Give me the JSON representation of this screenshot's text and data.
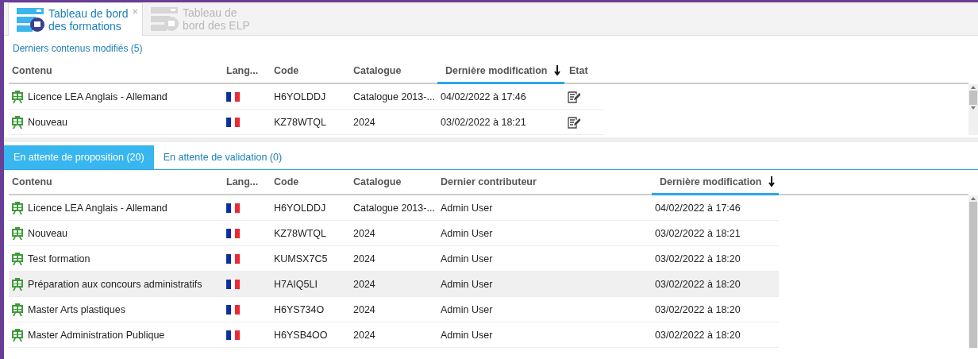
{
  "tabs": [
    {
      "label_lines": [
        "Tableau de bord",
        "des formations"
      ],
      "selected": true,
      "close": "×"
    },
    {
      "label_lines": [
        "Tableau de",
        "bord des ELP"
      ],
      "selected": false
    }
  ],
  "recent": {
    "title": "Derniers contenus modifiés (5)",
    "columns": [
      {
        "label": "Contenu",
        "kind": "content",
        "sorted": false
      },
      {
        "label": "Lang...",
        "kind": "language",
        "sorted": false
      },
      {
        "label": "Code",
        "kind": "code",
        "sorted": false
      },
      {
        "label": "Catalogue",
        "kind": "catalogue",
        "sorted": false
      },
      {
        "label": "Dernière modification",
        "kind": "modified",
        "sorted": true
      },
      {
        "label": "Etat",
        "kind": "status",
        "sorted": false
      }
    ],
    "rows": [
      {
        "content": "Licence LEA Anglais - Allemand",
        "code": "H6YOLDDJ",
        "catalogue": "Catalogue 2013-...",
        "modified": "04/02/2022 à 17:46",
        "highlighted": false
      },
      {
        "content": "Nouveau",
        "code": "KZ78WTQL",
        "catalogue": "2024",
        "modified": "03/02/2022 à 18:21",
        "highlighted": false
      }
    ]
  },
  "subtabs": [
    {
      "label": "En attente de proposition (20)",
      "selected": true
    },
    {
      "label": "En attente de validation (0)",
      "selected": false
    }
  ],
  "pending": {
    "columns": [
      {
        "label": "Contenu",
        "kind": "content",
        "sorted": false
      },
      {
        "label": "Lang...",
        "kind": "language",
        "sorted": false
      },
      {
        "label": "Code",
        "kind": "code",
        "sorted": false
      },
      {
        "label": "Catalogue",
        "kind": "catalogue",
        "sorted": false
      },
      {
        "label": "Dernier contributeur",
        "kind": "contributor",
        "sorted": false
      },
      {
        "label": "Dernière modification",
        "kind": "modified",
        "sorted": true
      }
    ],
    "rows": [
      {
        "content": "Licence LEA Anglais - Allemand",
        "code": "H6YOLDDJ",
        "catalogue": "Catalogue 2013-...",
        "contributor": "Admin User",
        "modified": "04/02/2022 à 17:46",
        "highlighted": false
      },
      {
        "content": "Nouveau",
        "code": "KZ78WTQL",
        "catalogue": "2024",
        "contributor": "Admin User",
        "modified": "03/02/2022 à 18:21",
        "highlighted": false
      },
      {
        "content": "Test formation",
        "code": "KUMSX7C5",
        "catalogue": "2024",
        "contributor": "Admin User",
        "modified": "03/02/2022 à 18:20",
        "highlighted": false
      },
      {
        "content": "Préparation aux concours administratifs",
        "code": "H7AIQ5LI",
        "catalogue": "2024",
        "contributor": "Admin User",
        "modified": "03/02/2022 à 18:20",
        "highlighted": true
      },
      {
        "content": "Master Arts plastiques",
        "code": "H6YS734O",
        "catalogue": "2024",
        "contributor": "Admin User",
        "modified": "03/02/2022 à 18:20",
        "highlighted": false
      },
      {
        "content": "Master Administration Publique",
        "code": "H6YSB4OO",
        "catalogue": "2024",
        "contributor": "Admin User",
        "modified": "03/02/2022 à 18:20",
        "highlighted": false
      }
    ]
  }
}
